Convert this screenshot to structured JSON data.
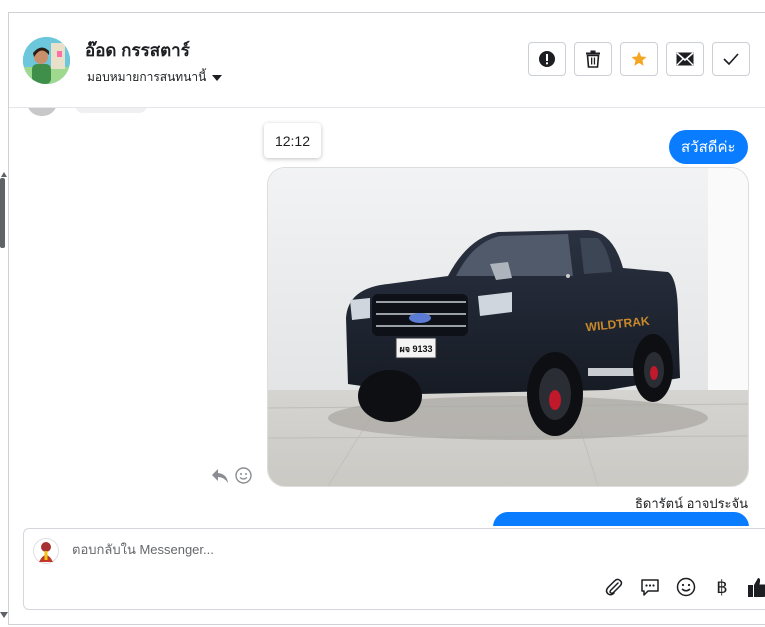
{
  "header": {
    "contact_name": "อ๊อด กรรสตาร์",
    "assign_label": "มอบหมายการสนทนานี้",
    "actions": [
      {
        "name": "report-spam",
        "icon": "exclamation-circle-icon"
      },
      {
        "name": "delete",
        "icon": "trash-icon"
      },
      {
        "name": "star",
        "icon": "star-icon",
        "color": "#f5a623"
      },
      {
        "name": "mark-unread",
        "icon": "envelope-icon"
      },
      {
        "name": "mark-done",
        "icon": "checkmark-icon"
      }
    ]
  },
  "conversation": {
    "timestamp": "12:12",
    "outgoing_message": "สวัสดีค่ะ",
    "sender_name": "ธิดารัตน์ อาจประจัน",
    "photo": {
      "subject": "black-pickup-truck",
      "plate_text": "ผจ 9133",
      "decal_text": "WILDTRAK"
    },
    "message_actions": [
      "reply-icon",
      "emoji-reaction-icon"
    ]
  },
  "composer": {
    "placeholder": "ตอบกลับใน Messenger...",
    "tools": [
      "paperclip-icon",
      "saved-reply-icon",
      "emoji-icon",
      "baht-icon",
      "thumbs-up-icon"
    ],
    "baht_symbol": "฿"
  },
  "colors": {
    "accent": "#0a7cff",
    "star": "#f5a623"
  }
}
